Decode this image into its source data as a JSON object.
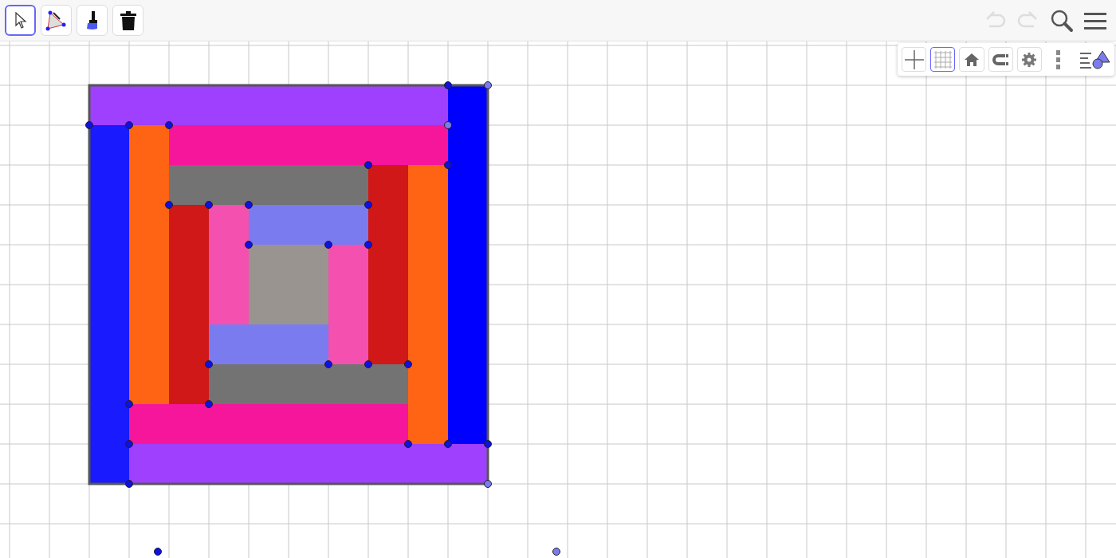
{
  "toolbar": {
    "tools": [
      {
        "kind": "move",
        "selected": true
      },
      {
        "kind": "polygon",
        "selected": false
      },
      {
        "kind": "brush",
        "selected": false
      },
      {
        "kind": "delete",
        "selected": false
      }
    ]
  },
  "actions": {
    "undo_disabled": true,
    "redo_disabled": true
  },
  "style_bar": {
    "axes_selected": false,
    "grid_selected": true
  },
  "polygons": [
    {
      "color": "#a040ff"
    },
    {
      "color": "#0000ff"
    },
    {
      "color": "#1a1aff"
    },
    {
      "color": "#a040ff"
    },
    {
      "color": "#ff6414"
    },
    {
      "color": "#f5169c"
    },
    {
      "color": "#ff6414"
    },
    {
      "color": "#f5169c"
    },
    {
      "color": "#737373"
    },
    {
      "color": "#d01818"
    },
    {
      "color": "#d01818"
    },
    {
      "color": "#737373"
    },
    {
      "color": "#f450b0"
    },
    {
      "color": "#7b7bf0"
    },
    {
      "color": "#f450b0"
    },
    {
      "color": "#7b7bf0"
    },
    {
      "color": "#999490"
    }
  ]
}
